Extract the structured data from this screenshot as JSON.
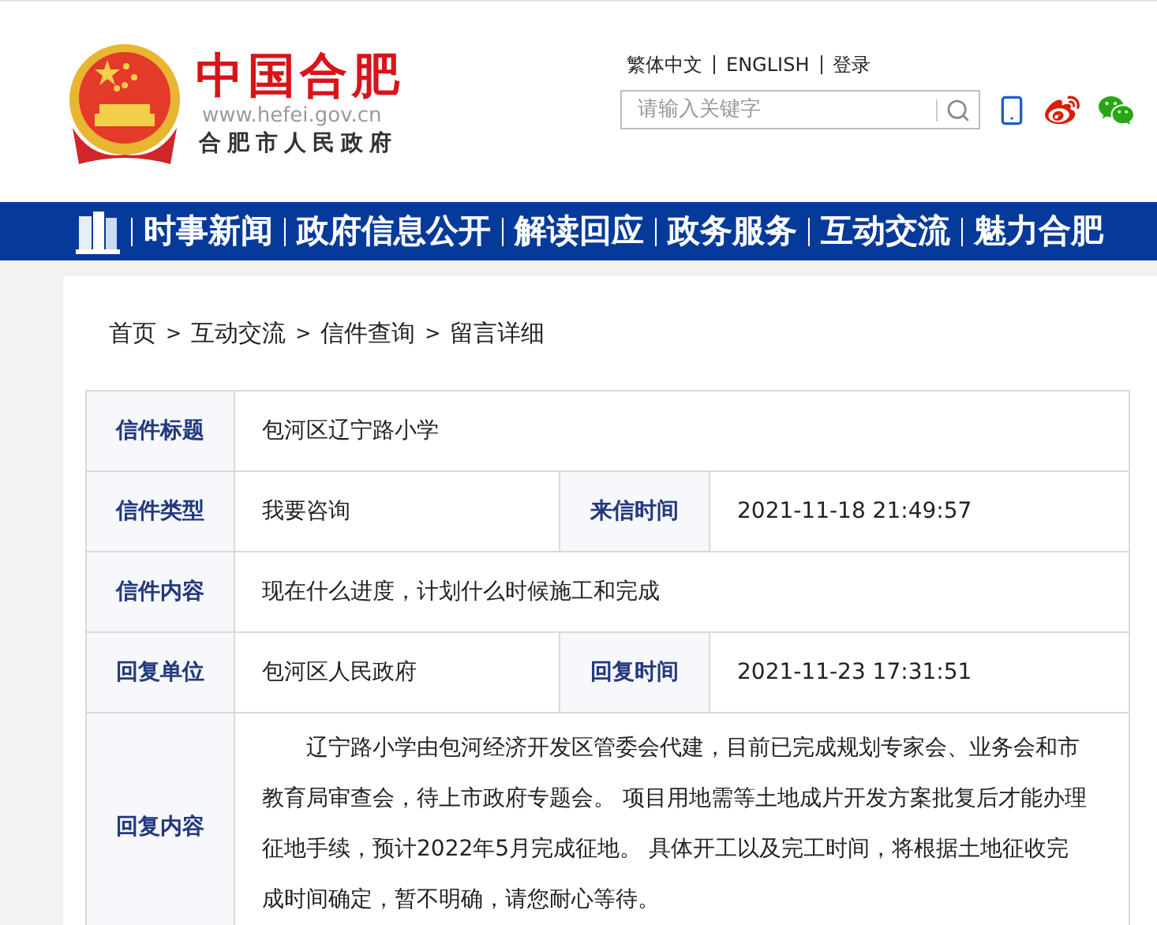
{
  "header": {
    "site_title": "中国合肥",
    "site_url": "www.hefei.gov.cn",
    "site_subtitle": "合肥市人民政府",
    "top_links": [
      "繁体中文",
      "ENGLISH",
      "登录"
    ],
    "search": {
      "placeholder": "请输入关键字"
    }
  },
  "nav": {
    "items": [
      "时事新闻",
      "政府信息公开",
      "解读回应",
      "政务服务",
      "互动交流",
      "魅力合肥"
    ]
  },
  "breadcrumb": {
    "separator": ">",
    "items": [
      "首页",
      "互动交流",
      "信件查询",
      "留言详细"
    ]
  },
  "detail": {
    "rows": [
      {
        "kind": "single",
        "label": "信件标题",
        "value": "包河区辽宁路小学"
      },
      {
        "kind": "pair",
        "label": "信件类型",
        "value": "我要咨询",
        "label_2": "来信时间",
        "value_2": "2021-11-18 21:49:57"
      },
      {
        "kind": "single",
        "label": "信件内容",
        "value": "现在什么进度，计划什么时候施工和完成"
      },
      {
        "kind": "pair",
        "label": "回复单位",
        "value": "包河区人民政府",
        "label_2": "回复时间",
        "value_2": "2021-11-23 17:31:51"
      },
      {
        "kind": "paragraph",
        "label": "回复内容",
        "value": "辽宁路小学由包河经济开发区管委会代建，目前已完成规划专家会、业务会和市教育局审查会，待上市政府专题会。 项目用地需等土地成片开发方案批复后才能办理征地手续，预计2022年5月完成征地。 具体开工以及完工时间，将根据土地征收完成时间确定，暂不明确，请您耐心等待。"
      }
    ]
  }
}
